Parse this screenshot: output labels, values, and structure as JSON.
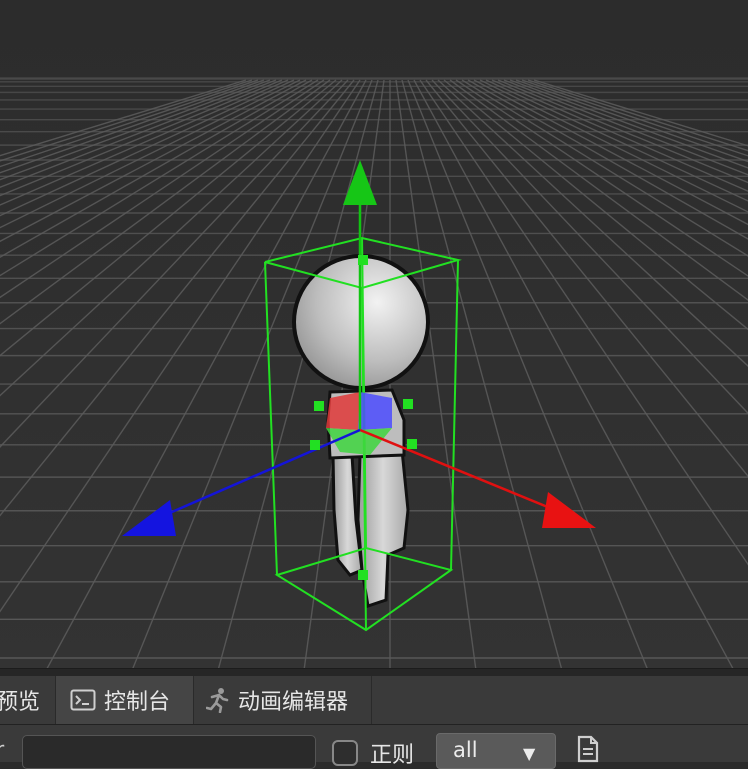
{
  "tabs": [
    {
      "id": "preview",
      "label": "预览"
    },
    {
      "id": "console",
      "label": "控制台",
      "icon": "terminal-icon",
      "active": true
    },
    {
      "id": "animation",
      "label": "动画编辑器",
      "icon": "running-figure-icon"
    }
  ],
  "toolbar": {
    "filter_left_glyph": "r",
    "filter_value": "",
    "regex_label": "正则",
    "regex_checked": false,
    "level_value": "all",
    "level_caret": "▼",
    "clear_icon": "document-icon"
  },
  "scene": {
    "gizmo_colors": {
      "x": "#e01010",
      "y": "#11c411",
      "z": "#1414d8"
    },
    "bounds_color": "#22e022",
    "grid_color": "#5a5a5a"
  }
}
